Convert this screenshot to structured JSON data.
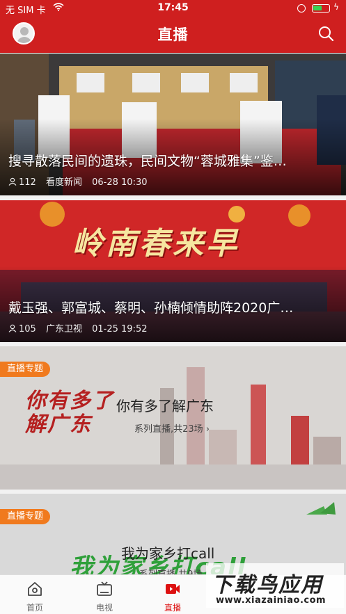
{
  "status_bar": {
    "carrier": "无 SIM 卡",
    "time": "17:45",
    "battery_level": 0.55,
    "battery_color": "#39d353"
  },
  "header": {
    "title": "直播",
    "avatar_icon": "user-avatar-icon",
    "search_icon": "search-icon",
    "background": "#cf1f1f"
  },
  "feed": [
    {
      "title": "搜寻散落民间的遗珠，民间文物“蓉城雅集”鉴…",
      "viewers": "112",
      "source": "看度新闻",
      "time": "06-28 10:30"
    },
    {
      "title": "戴玉强、郭富城、蔡明、孙楠倾情助阵2020广…",
      "viewers": "105",
      "source": "广东卫视",
      "time": "01-25 19:52",
      "banner_text": "岭南春来早"
    }
  ],
  "topics": [
    {
      "badge": "直播专题",
      "title": "你有多了解广东",
      "subtitle": "系列直播,共23场 ›",
      "art_text": "你有多了解广东"
    },
    {
      "badge": "直播专题",
      "title": "我为家乡打call",
      "subtitle": "系列直播,共9场",
      "art_text": "我为家乡打call"
    }
  ],
  "tabbar": {
    "tabs": [
      {
        "label": "首页",
        "icon": "home-icon"
      },
      {
        "label": "电视",
        "icon": "tv-icon"
      },
      {
        "label": "直播",
        "icon": "live-video-icon"
      }
    ],
    "active_color": "#dd1111"
  },
  "watermark": {
    "text": "下载鸟应用",
    "url": "www.xiazainiao.com"
  }
}
